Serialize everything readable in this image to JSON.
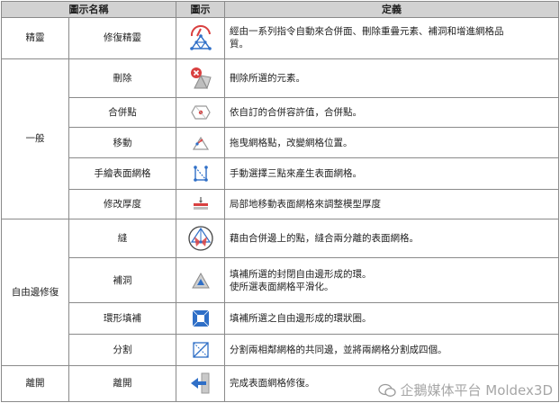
{
  "headers": {
    "category": "圖示名稱",
    "icon": "圖示",
    "definition": "定義"
  },
  "rows": [
    {
      "category": "精靈",
      "name": "修復精靈",
      "icon": "repair-wizard-icon",
      "definition": [
        "經由一系列指令自動來合併面、刪除重疊元素、補洞和增進網格品",
        "質。"
      ]
    },
    {
      "category": "一般",
      "name": "刪除",
      "icon": "delete-icon",
      "definition": [
        "刪除所選的元素。"
      ]
    },
    {
      "name": "合併點",
      "icon": "merge-nodes-icon",
      "definition": [
        "依自訂的合併容許值，合併點。"
      ]
    },
    {
      "name": "移動",
      "icon": "move-icon",
      "definition": [
        "拖曳網格點，改變網格位置。"
      ]
    },
    {
      "name": "手繪表面網格",
      "icon": "hand-draw-mesh-icon",
      "definition": [
        "手動選擇三點來產生表面網格。"
      ]
    },
    {
      "name": "修改厚度",
      "icon": "modify-thickness-icon",
      "definition": [
        "局部地移動表面網格來調整模型厚度"
      ]
    },
    {
      "category": "自由邊修復",
      "name": "縫",
      "icon": "stitch-icon",
      "definition": [
        "藉由合併邊上的點，縫合兩分離的表面網格。"
      ]
    },
    {
      "name": "補洞",
      "icon": "fill-hole-icon",
      "definition": [
        "填補所選的封閉自由邊形成的環。",
        "使所選表面網格平滑化。"
      ]
    },
    {
      "name": "環形填補",
      "icon": "ring-fill-icon",
      "definition": [
        "填補所選之自由邊形成的環狀圈。"
      ]
    },
    {
      "name": "分割",
      "icon": "split-icon",
      "definition": [
        "分割兩相鄰網格的共同邊，並將兩網格分割成四個。"
      ]
    },
    {
      "category": "離開",
      "name": "離開",
      "icon": "exit-icon",
      "definition": [
        "完成表面網格修復。"
      ]
    }
  ],
  "watermark": {
    "text": "企鵝媒体平台 Moldex3D",
    "logo": "wechat-logo-icon"
  },
  "colors": {
    "header_bg": "#d2d2d2",
    "border": "#8a8a8a",
    "icon_blue": "#2f6fc7",
    "icon_red": "#d94040"
  }
}
